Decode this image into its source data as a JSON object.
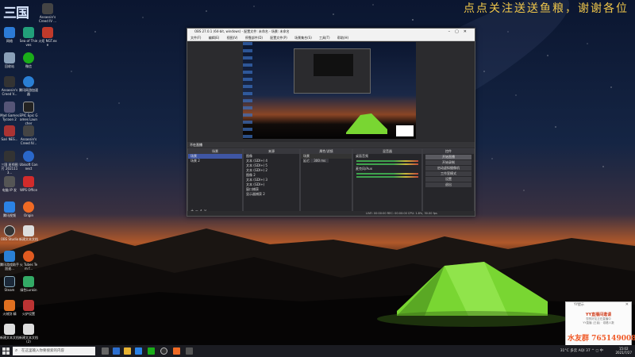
{
  "overlay": {
    "logo": "三国",
    "marquee": "点点关注送送鱼粮，谢谢各位"
  },
  "desktop_icons": [
    {
      "label": "Assassin's Creed IV ...",
      "icon": "game-icon",
      "color": "#444"
    },
    {
      "label": "网络",
      "icon": "network-icon",
      "color": "#2c7bd6"
    },
    {
      "label": "Sea of Thieves",
      "icon": "game-icon",
      "color": "#22a07a"
    },
    {
      "label": "火炬 NGT.exe",
      "icon": "app-icon",
      "color": "#c03a2b"
    },
    {
      "label": "回收站",
      "icon": "recycle-bin-icon",
      "color": "#8aa0b8"
    },
    {
      "label": "微信",
      "icon": "wechat-icon",
      "color": "#1aad19"
    },
    {
      "label": "Assassin's Creed V...",
      "icon": "game-icon",
      "color": "#333"
    },
    {
      "label": "腾讯网游加速器",
      "icon": "app-icon",
      "color": "#2a7fd4"
    },
    {
      "label": "Mad Games Tycoon 2",
      "icon": "game-icon",
      "color": "#557"
    },
    {
      "label": "EPIC Epic Games Launcher",
      "icon": "epic-icon",
      "color": "#222"
    },
    {
      "label": "Sari NES...",
      "icon": "app-icon",
      "color": "#a33"
    },
    {
      "label": "Assassin's Creed IV...",
      "icon": "game-icon",
      "color": "#444"
    },
    {
      "label": "三国 班师图片 2021113...",
      "icon": "folder-icon",
      "color": "#333"
    },
    {
      "label": "Ubisoft Connect",
      "icon": "ubisoft-icon",
      "color": "#2a67c9"
    },
    {
      "label": "电脑 IP 发",
      "icon": "app-icon",
      "color": "#555"
    },
    {
      "label": "WPS Office",
      "icon": "wps-icon",
      "color": "#d12b2b"
    },
    {
      "label": "腾讯视频",
      "icon": "app-icon",
      "color": "#2b82e6"
    },
    {
      "label": "Origin",
      "icon": "origin-icon",
      "color": "#f06a24"
    },
    {
      "label": "OBS Studio",
      "icon": "obs-icon",
      "color": "#333"
    },
    {
      "label": "新建文本文档",
      "icon": "text-file-icon",
      "color": "#ddd"
    },
    {
      "label": "腾讯游戏助手 加速...",
      "icon": "app-icon",
      "color": "#2a7fd4"
    },
    {
      "label": "火 Tubes Tem f...",
      "icon": "app-icon",
      "color": "#e05a20"
    },
    {
      "label": "Steam",
      "icon": "steam-icon",
      "color": "#1b2838"
    },
    {
      "label": "绿色Lunkin",
      "icon": "app-icon",
      "color": "#3a6"
    },
    {
      "label": "火绒剑 精",
      "icon": "app-icon",
      "color": "#e07020"
    },
    {
      "label": "火炉设置",
      "icon": "app-icon",
      "color": "#b33"
    },
    {
      "label": "新建文本文档",
      "icon": "text-file-icon",
      "color": "#ddd"
    },
    {
      "label": "新建文本文档 (2)",
      "icon": "text-file-icon",
      "color": "#ddd"
    }
  ],
  "obs": {
    "title": "OBS 27.0.1 (64-bit, windows) - 配置文件: 未命名 - 场景: 未命名",
    "menu": [
      "文件(F)",
      "编辑(E)",
      "视图(V)",
      "停靠部件(D)",
      "配置文件(P)",
      "场景集合(S)",
      "工具(T)",
      "帮助(H)"
    ],
    "scene_label": "不在直播",
    "docks": {
      "scenes": {
        "header": "场景",
        "items": [
          "场景",
          "场景 2"
        ]
      },
      "sources": {
        "header": "来源",
        "items": [
          "图像",
          "文本 (GDI+) 4",
          "文本 (GDI+) 5",
          "文本 (GDI+) 2",
          "图像 2",
          "文本 (GDI+) 3",
          "文本 (GDI+)",
          "窗口捕获",
          "显示器捕获 2"
        ]
      },
      "filters": {
        "header": "属性/滤镜",
        "label1": "场景",
        "label2": "延迟",
        "value2": "300 ms"
      },
      "mixer": {
        "header": "混音器",
        "ch1": "桌面音频",
        "ch2": "麦克风/Aux"
      },
      "controls": {
        "header": "控件",
        "buttons": [
          "开始直播",
          "开始录制",
          "启动虚拟摄像机",
          "工作室模式",
          "设置",
          "退出"
        ]
      }
    },
    "status": "LIVE: 00:00:00  REC: 00:00:00  CPU: 1.8%, 30.00 fps"
  },
  "popup": {
    "header": "YY提示",
    "title": "YY直播间邀请",
    "body1": "您的好友正在直播中",
    "body2": "YY直播 (王者) · 观看人数",
    "overlay_text": "水友群 765149008"
  },
  "taskbar": {
    "search_placeholder": "在这里输入你要搜索的内容",
    "tray_text": "31°C  多云  AQI 37  ^  ◻  中",
    "time": "15:02",
    "date": "2021/7/27"
  },
  "colors": {
    "taskbar": "#1b1c22",
    "accent_tent": "#7ee03a",
    "marquee": "#f0c74a"
  }
}
